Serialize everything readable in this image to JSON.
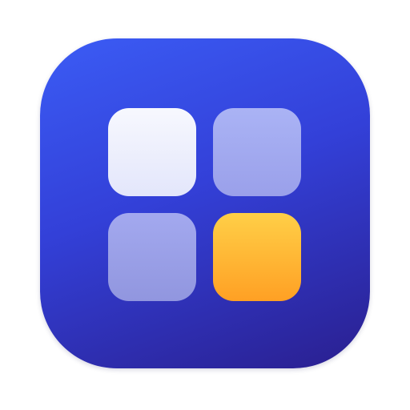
{
  "icon": {
    "name": "app-grid-icon",
    "colors": {
      "background_top": "#3b5cf5",
      "background_mid": "#3340d8",
      "background_bottom": "#2a1f8f",
      "tile_top_left": [
        "#f7f8fe",
        "#e3e6fb"
      ],
      "tile_top_right": [
        "#aab3f5",
        "#9aa0ea"
      ],
      "tile_bottom_left": [
        "#a3a9ef",
        "#9196df"
      ],
      "tile_bottom_right": [
        "#ffcf47",
        "#ffa024"
      ]
    },
    "tiles": [
      {
        "name": "tile-top-left",
        "accent": false
      },
      {
        "name": "tile-top-right",
        "accent": false
      },
      {
        "name": "tile-bottom-left",
        "accent": false
      },
      {
        "name": "tile-bottom-right",
        "accent": true
      }
    ]
  }
}
